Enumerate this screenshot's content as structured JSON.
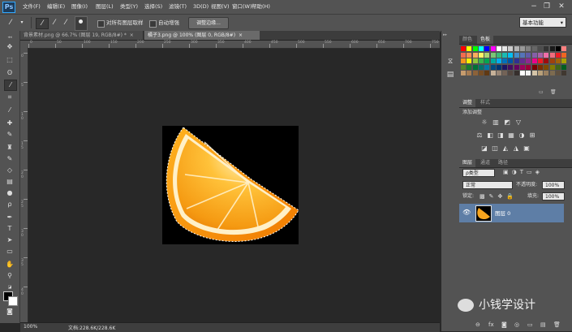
{
  "app": {
    "logo": "Ps"
  },
  "menu": [
    "文件(F)",
    "编辑(E)",
    "图像(I)",
    "图层(L)",
    "类型(Y)",
    "选择(S)",
    "滤镜(T)",
    "3D(D)",
    "视图(V)",
    "窗口(W)",
    "帮助(H)"
  ],
  "window_controls": {
    "minimize": "−",
    "restore": "❐",
    "close": "✕"
  },
  "options": {
    "sample_all_layers": "对所有图层取样",
    "auto_enhance": "自动增强",
    "refine_edge": "调整边缘...",
    "workspace": "基本功能"
  },
  "tabs": [
    {
      "label": "背景素材.png @ 66.7% (图层 19, RGB/8#) *",
      "close": "×",
      "active": false
    },
    {
      "label": "橘子3.png @ 100% (图层 0, RGB/8#)",
      "close": "×",
      "active": true
    }
  ],
  "ruler_top": [
    "0",
    "50",
    "100",
    "150",
    "200",
    "250",
    "300",
    "350",
    "400",
    "450",
    "500",
    "550",
    "600",
    "650",
    "700",
    "750"
  ],
  "ruler_left": [
    "0",
    "5",
    "1\n0",
    "1\n5",
    "2\n0",
    "2\n5",
    "3\n0",
    "3\n5",
    "4\n0"
  ],
  "status": {
    "zoom": "100%",
    "doc": "文档:228.6K/228.6K"
  },
  "color_panel": {
    "tabs": [
      "颜色",
      "色板"
    ],
    "active_tab": "色板"
  },
  "swatch_colors": [
    [
      "#ff0000",
      "#ffff00",
      "#00ff00",
      "#00ffff",
      "#0000ff",
      "#ff00ff",
      "#ffffff",
      "#e6e6e6",
      "#cccccc",
      "#b3b3b3",
      "#999999",
      "#808080",
      "#666666",
      "#4d4d4d",
      "#333333",
      "#1a1a1a",
      "#000000",
      "#ff8080"
    ],
    [
      "#f26c4f",
      "#f68e55",
      "#fbaf5c",
      "#fff467",
      "#acd372",
      "#7cc576",
      "#3bb878",
      "#1abbb4",
      "#00bff3",
      "#438ccb",
      "#5574b9",
      "#605ca8",
      "#855fa8",
      "#a763a9",
      "#ef6ea8",
      "#f16d7e",
      "#ee1d24",
      "#f16522"
    ],
    [
      "#f7941d",
      "#fff200",
      "#8fc63d",
      "#37b44a",
      "#00a650",
      "#00a99e",
      "#00aeef",
      "#0072bc",
      "#0054a5",
      "#2f3192",
      "#652c91",
      "#91278f",
      "#ec008c",
      "#ed1c24",
      "#9e0b0f",
      "#a0410d",
      "#a3620a",
      "#aba000"
    ],
    [
      "#588528",
      "#197b30",
      "#007236",
      "#00736a",
      "#0076a4",
      "#004a80",
      "#003471",
      "#1b1464",
      "#440e62",
      "#630460",
      "#9e005d",
      "#9e0039",
      "#790000",
      "#7b2e00",
      "#7d4900",
      "#827b00",
      "#406618",
      "#005e20"
    ],
    [
      "#c69c6d",
      "#a67c52",
      "#8c6239",
      "#754c24",
      "#603913",
      "#c7b299",
      "#998675",
      "#736357",
      "#534741",
      "#362f2d",
      "#fff",
      "#f0f0f0",
      "#d4c4a8",
      "#b8a07a",
      "#9a8060",
      "#7d6b4f",
      "#5e5040",
      "#403830"
    ]
  ],
  "adjustments_panel": {
    "tabs": [
      "调整",
      "样式"
    ],
    "active_tab": "调整",
    "title": "添加调整"
  },
  "adjust_icons_row1": [
    "☼",
    "▥",
    "◩",
    "▽"
  ],
  "adjust_icons_row2": [
    "⚖",
    "◧",
    "◨",
    "▦",
    "◑",
    "⊞"
  ],
  "adjust_icons_row3": [
    "◪",
    "◫",
    "◭",
    "◮",
    "▣"
  ],
  "layers_panel": {
    "tabs": [
      "图层",
      "通道",
      "路径"
    ],
    "active_tab": "图层",
    "filter": "ρ类型",
    "blend_mode": "正常",
    "opacity_label": "不透明度:",
    "opacity": "100%",
    "lock_label": "锁定:",
    "fill_label": "填充:",
    "fill": "100%",
    "layers": [
      {
        "name": "图层 0",
        "visible": true,
        "selected": true
      }
    ],
    "bottom_icons": [
      "⊖",
      "fx",
      "◙",
      "◎",
      "▭",
      "▤",
      "🗑"
    ]
  },
  "watermark": "小钱学设计",
  "accent": "#5e7ea6"
}
